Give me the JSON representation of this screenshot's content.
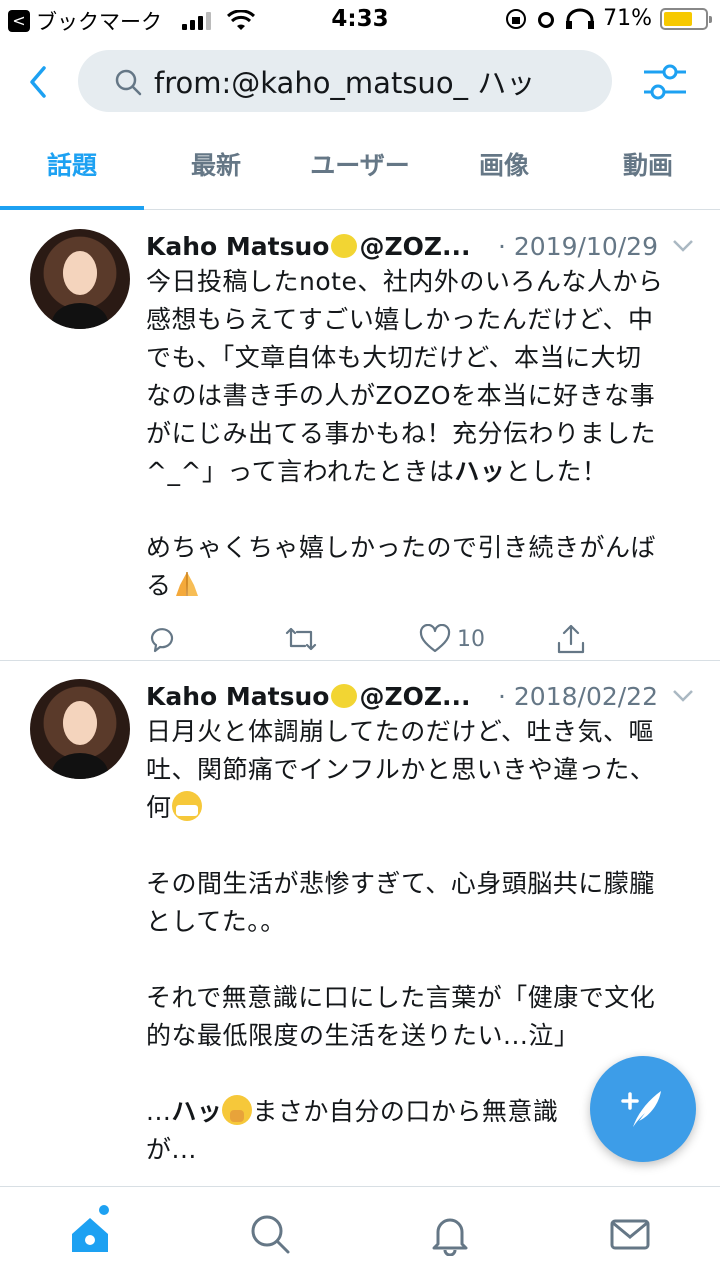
{
  "status_bar": {
    "back_app_label": "ブックマーク",
    "time": "4:33",
    "battery_percent": "71%",
    "battery_level": 0.71
  },
  "search": {
    "query": "from:@kaho_matsuo_ ハッ"
  },
  "tabs": [
    {
      "label": "話題",
      "active": true
    },
    {
      "label": "最新",
      "active": false
    },
    {
      "label": "ユーザー",
      "active": false
    },
    {
      "label": "画像",
      "active": false
    },
    {
      "label": "動画",
      "active": false
    }
  ],
  "tweets": [
    {
      "name": "Kaho Matsuo",
      "handle": "@ZOZ...",
      "date": "· 2019/10/29",
      "lines": [
        "今日投稿したnote、社内外のいろんな人から",
        "感想もらえてすごい嬉しかったんだけど、中",
        "でも、「文章自体も大切だけど、本当に大切",
        "なのは書き手の人がZOZOを本当に好きな事",
        "がにじみ出てる事かもね！充分伝わりました",
        "^_^」って言われたときは",
        "ハッ",
        "とした！",
        "めちゃくちゃ嬉しかったので引き続きがんば",
        "る"
      ],
      "likes": "10"
    },
    {
      "name": "Kaho Matsuo",
      "handle": "@ZOZ...",
      "date": "· 2018/02/22",
      "lines": [
        "日月火と体調崩してたのだけど、吐き気、嘔",
        "吐、関節痛でインフルかと思いきや違った、",
        "何",
        "その間生活が悲惨すぎて、心身頭脳共に朦朧",
        "としてた。。",
        "それで無意識に口にした言葉が「健康で文化",
        "的な最低限度の生活を送りたい...泣」",
        "...",
        "ハッ",
        "まさか自分の口から無意識",
        "が..."
      ]
    }
  ],
  "colors": {
    "accent": "#1da1f2",
    "secondary_text": "#657786",
    "fab": "#3d9de8"
  },
  "icons": [
    "back-chevron-icon",
    "search-icon",
    "filter-icon",
    "reply-icon",
    "retweet-icon",
    "heart-icon",
    "share-icon",
    "home-icon",
    "explore-icon",
    "notifications-icon",
    "messages-icon",
    "compose-icon"
  ]
}
